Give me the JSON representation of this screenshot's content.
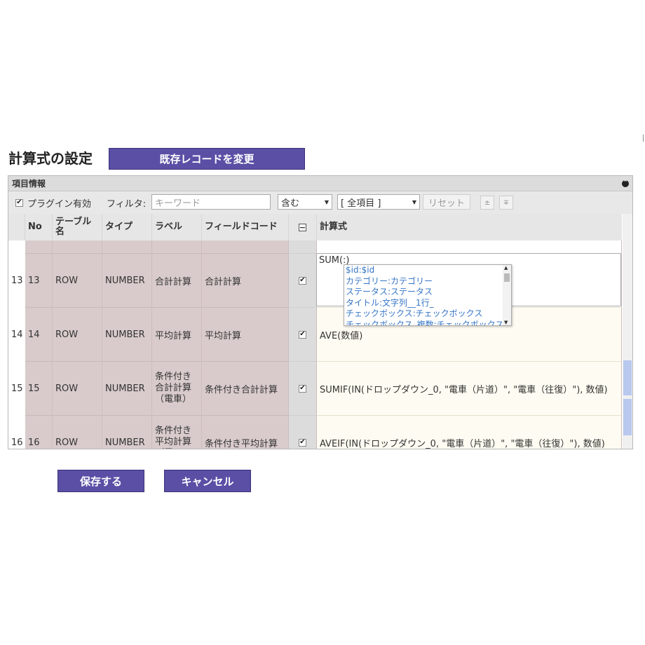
{
  "page": {
    "title": "計算式の設定",
    "top_button": "既存レコードを変更",
    "save": "保存する",
    "cancel": "キャンセル"
  },
  "panel": {
    "header": "項目情報",
    "collapse_icon": "collapse-circle-icon",
    "toolbar": {
      "plugin_enabled_label": "プラグイン有効",
      "plugin_enabled_checked": true,
      "filter_label": "フィルタ:",
      "keyword_placeholder": "キーワード",
      "match_select": "含む",
      "field_select": "[ 全項目 ]",
      "reset": "リセット",
      "sort_asc": "±",
      "sort_desc": "∓"
    },
    "columns": [
      "No",
      "テーブル名",
      "タイプ",
      "ラベル",
      "フィールドコード",
      "計算式"
    ]
  },
  "rows": [
    {
      "rownum": "13",
      "no": "13",
      "table": "ROW",
      "type": "NUMBER",
      "label": "合計計算",
      "code": "合計計算",
      "checked": true,
      "formula": "SUM(:)"
    },
    {
      "rownum": "14",
      "no": "14",
      "table": "ROW",
      "type": "NUMBER",
      "label": "平均計算",
      "code": "平均計算",
      "checked": true,
      "formula": "AVE(数値)"
    },
    {
      "rownum": "15",
      "no": "15",
      "table": "ROW",
      "type": "NUMBER",
      "label": "条件付き合計計算（電車）",
      "code": "条件付き合計計算",
      "checked": true,
      "formula": "SUMIF(IN(ドロップダウン_0, \"電車（片道）\", \"電車（往復）\"), 数値)"
    },
    {
      "rownum": "16",
      "no": "16",
      "table": "ROW",
      "type": "NUMBER",
      "label": "条件付き平均計算（電",
      "code": "条件付き平均計算",
      "checked": true,
      "formula": "AVEIF(IN(ドロップダウン_0, \"電車（片道）\", \"電車（往復）\"), 数値)"
    }
  ],
  "autocomplete": [
    "$id:$id",
    "カテゴリー:カテゴリー",
    "ステータス:ステータス",
    "タイトル:文字列__1行_",
    "チェックボックス:チェックボックス",
    "チェックボックス_複数:チェックボックス_複数"
  ]
}
